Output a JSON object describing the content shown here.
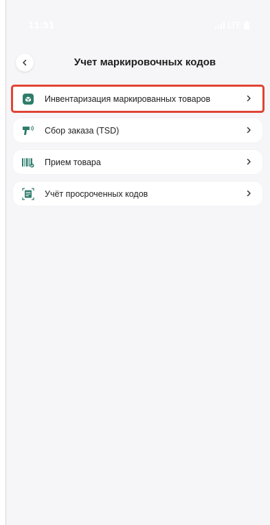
{
  "status_bar": {
    "time": "11:51",
    "network": "LTE"
  },
  "header": {
    "title": "Учет маркировочных кодов"
  },
  "menu": {
    "items": [
      {
        "label": "Инвентаризация маркированных товаров",
        "icon": "inventory-box-icon"
      },
      {
        "label": "Сбор заказа (TSD)",
        "icon": "scanner-gun-icon"
      },
      {
        "label": "Прием товара",
        "icon": "barcode-icon"
      },
      {
        "label": "Учёт просроченных кодов",
        "icon": "expired-code-icon"
      }
    ]
  },
  "colors": {
    "accent": "#2e7d6b",
    "highlight": "#e04334",
    "background": "#f6f6f8"
  }
}
